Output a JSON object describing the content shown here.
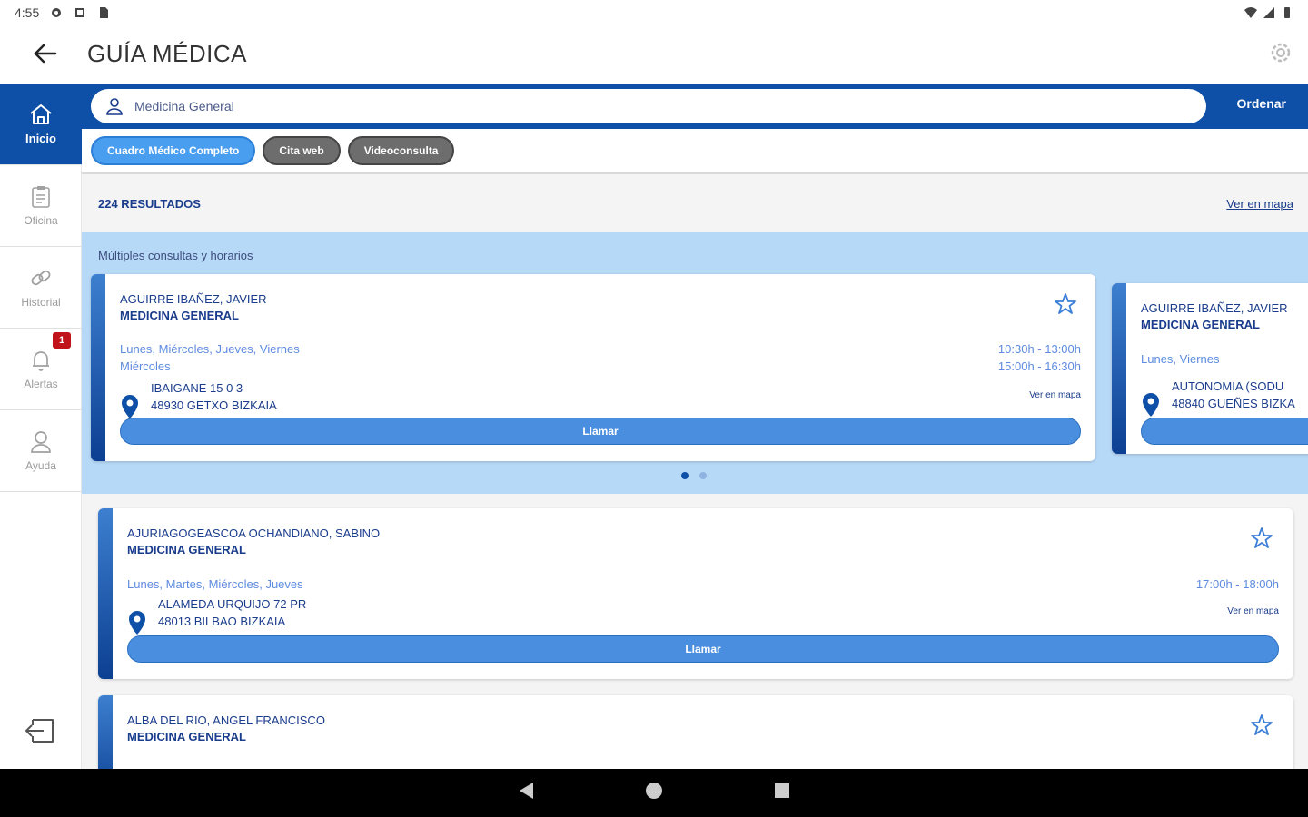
{
  "status_bar": {
    "time": "4:55",
    "left_icons": [
      "gear-icon",
      "square-icon",
      "sd-card-icon"
    ],
    "right_icons": [
      "wifi-icon",
      "signal-icon",
      "battery-icon"
    ]
  },
  "app_bar": {
    "title": "GUÍA MÉDICA"
  },
  "sidebar": {
    "items": [
      {
        "label": "Inicio",
        "icon": "home-icon",
        "active": true
      },
      {
        "label": "Oficina",
        "icon": "clipboard-icon",
        "active": false
      },
      {
        "label": "Historial",
        "icon": "link-icon",
        "active": false
      },
      {
        "label": "Alertas",
        "icon": "bell-icon",
        "active": false,
        "badge": "1"
      },
      {
        "label": "Ayuda",
        "icon": "person-icon",
        "active": false
      }
    ]
  },
  "search": {
    "value": "Medicina General",
    "order_label": "Ordenar"
  },
  "filters": [
    {
      "label": "Cuadro Médico Completo",
      "active": true
    },
    {
      "label": "Cita web",
      "active": false
    },
    {
      "label": "Videoconsulta",
      "active": false
    }
  ],
  "results": {
    "count_label": "224 RESULTADOS",
    "map_link": "Ver en mapa"
  },
  "multi_section": {
    "title": "Múltiples consultas y horarios",
    "cards": [
      {
        "name": "AGUIRRE IBAÑEZ, JAVIER",
        "specialty": "MEDICINA GENERAL",
        "days_line1": "Lunes, Miércoles, Jueves, Viernes",
        "days_line2": "Miércoles",
        "hours_line1": "10:30h - 13:00h",
        "hours_line2": "15:00h - 16:30h",
        "address_line1": "IBAIGANE 15 0 3",
        "address_line2": "48930 GETXO BIZKAIA",
        "map_link": "Ver en mapa",
        "call_label": "Llamar"
      },
      {
        "name": "AGUIRRE IBAÑEZ, JAVIER",
        "specialty": "MEDICINA GENERAL",
        "days_line1": "Lunes, Viernes",
        "address_line1": "AUTONOMIA (SODU",
        "address_line2": "48840 GUEÑES BIZKA"
      }
    ],
    "page_count": 2,
    "current_page": 1
  },
  "results_list": [
    {
      "name": "AJURIAGOGEASCOA OCHANDIANO, SABINO",
      "specialty": "MEDICINA GENERAL",
      "days": "Lunes, Martes, Miércoles, Jueves",
      "hours": "17:00h - 18:00h",
      "address_line1": "ALAMEDA URQUIJO 72 PR",
      "address_line2": "48013 BILBAO BIZKAIA",
      "map_link": "Ver en mapa",
      "call_label": "Llamar"
    },
    {
      "name": "ALBA DEL RIO, ANGEL FRANCISCO",
      "specialty": "MEDICINA GENERAL"
    }
  ],
  "colors": {
    "primary": "#0e4fa7",
    "accent": "#4a8ee0",
    "section_bg": "#b7d9f8",
    "badge": "#c0131a"
  }
}
